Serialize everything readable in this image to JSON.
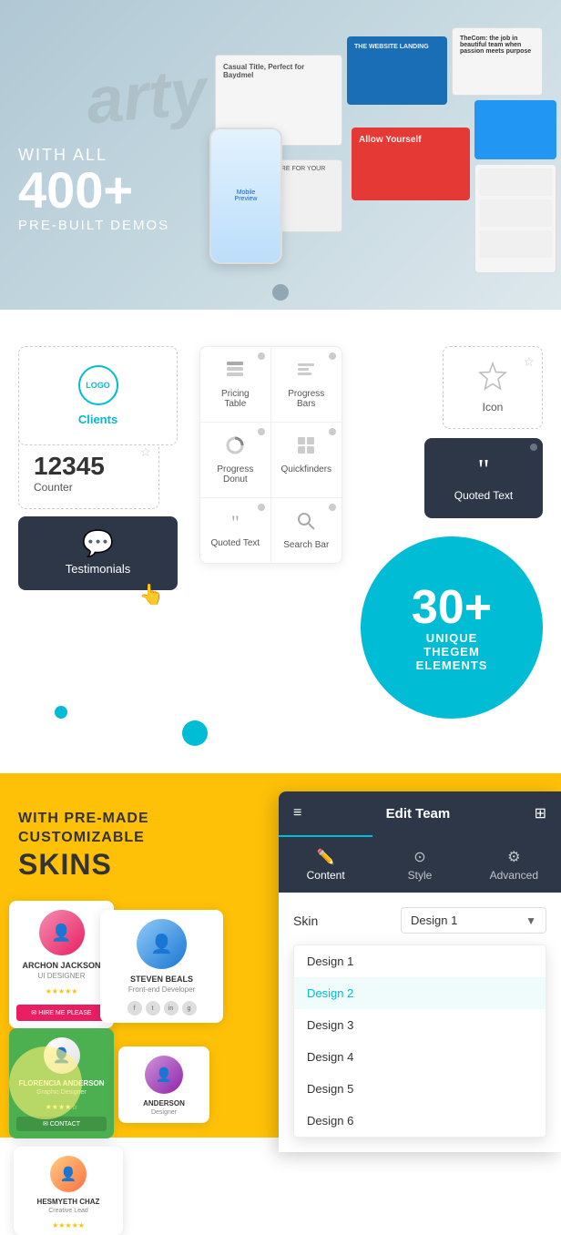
{
  "hero": {
    "with_all": "WITH ALL",
    "count": "400+",
    "pre_built": "PRE-BUILT DEMOS",
    "arty_text": "arty",
    "thumb1_text": "Casual Title, Perfect for Baydmel",
    "thumb2_text": "THE WEBSITE LANDING",
    "thumb3_text": "TheCom: the job in beautiful team when passion meets purpose",
    "thumb4_text": "",
    "thumb6_text": "Allow Yourself",
    "thumb_beauty": "THE BEST CARE FOR YOUR HAIR"
  },
  "elements": {
    "title": "30+",
    "subtitle1": "UNIQUE",
    "subtitle2": "THEGEM",
    "subtitle3": "ELEMENTS",
    "clients": {
      "logo_text": "LOGO",
      "label": "Clients"
    },
    "counter": {
      "number": "12345",
      "label": "Counter"
    },
    "testimonials": {
      "icon": "💬",
      "label": "Testimonials"
    },
    "icon_widget": {
      "label": "Icon"
    },
    "quoted_text": {
      "label": "Quoted Text"
    },
    "grid_items": [
      {
        "icon": "▦",
        "label": "Pricing Table"
      },
      {
        "icon": "≡",
        "label": "Progress Bars"
      },
      {
        "icon": "◎",
        "label": "Progress Donut"
      },
      {
        "icon": "⊞",
        "label": "Quickfinders"
      },
      {
        "icon": "❝",
        "label": "Quoted Text"
      },
      {
        "icon": "🔍",
        "label": "Search Bar"
      }
    ]
  },
  "skins": {
    "with_pre_made": "WITH PRE-MADE\nCUSTOMIZABLE",
    "skins_bold": "SKINS"
  },
  "edit_team": {
    "title": "Edit Team",
    "tabs": [
      {
        "icon": "✏️",
        "label": "Content"
      },
      {
        "icon": "⊙",
        "label": "Style"
      },
      {
        "icon": "⚙",
        "label": "Advanced"
      }
    ],
    "skin_label": "Skin",
    "skin_value": "Design 1",
    "dropdown": {
      "options": [
        {
          "label": "Design 1",
          "selected": false
        },
        {
          "label": "Design 2",
          "selected": true
        },
        {
          "label": "Design 3",
          "selected": false
        },
        {
          "label": "Design 4",
          "selected": false
        },
        {
          "label": "Design 5",
          "selected": false
        },
        {
          "label": "Design 6",
          "selected": false
        }
      ]
    }
  },
  "profiles": [
    {
      "name": "ARCHON JACKSON",
      "role": "UI DESIGNER",
      "avatar_color": "#e91e63"
    },
    {
      "name": "STEVEN BEALS",
      "role": "Developer",
      "avatar_color": "#1976d2"
    },
    {
      "name": "FLORENCIA ANDERSON",
      "role": "Designer",
      "avatar_color": "#8e24aa"
    },
    {
      "name": "HESMYETH CHAZ",
      "role": "Creative",
      "avatar_color": "#ff7043"
    }
  ]
}
